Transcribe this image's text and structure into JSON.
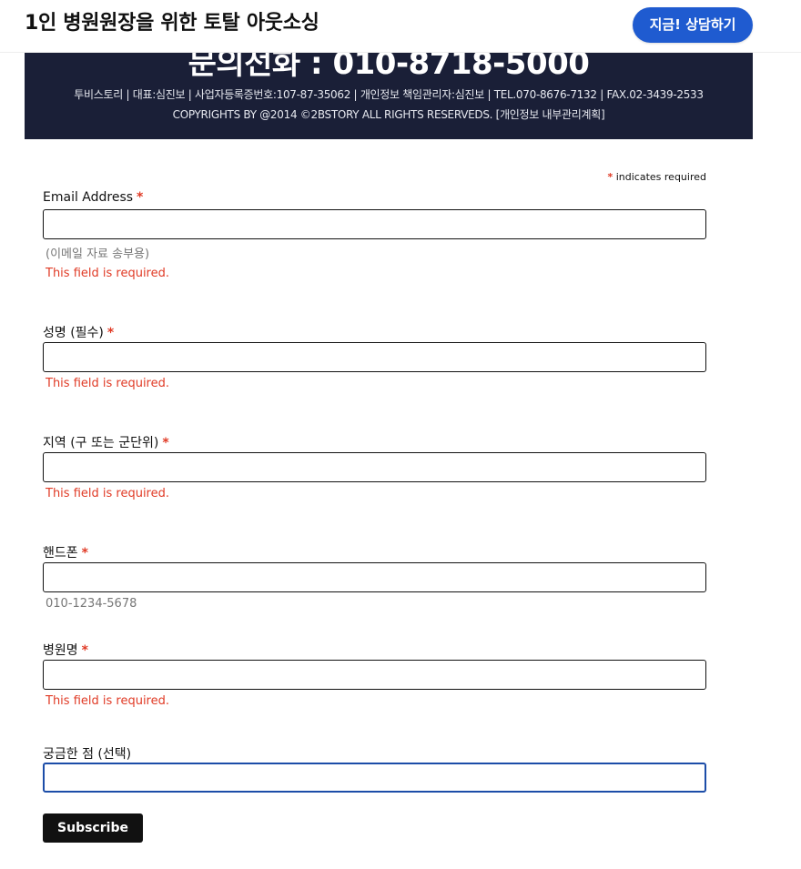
{
  "header": {
    "site_title": "1인 병원원장을 위한 토탈 아웃소싱",
    "cta_label": "지금! 상담하기"
  },
  "banner": {
    "phone": "문의전화 : 010-8718-5000",
    "company_line": "투비스토리 | 대표:심진보 | 사업자등록증번호:107-87-35062 | 개인정보 책임관리자:심진보 | TEL.070-8676-7132 | FAX.02-3439-2533",
    "copyright_line": "COPYRIGHTS BY @2014 ©2BSTORY ALL RIGHTS RESERVEDS. [개인정보 내부관리계획]"
  },
  "form": {
    "required_mark": "*",
    "required_note": "indicates required",
    "fields": [
      {
        "label": "Email Address",
        "required": true,
        "value": "",
        "helper": "(이메일 자료 송부용)",
        "error": "This field is required."
      },
      {
        "label": "성명 (필수)",
        "required": true,
        "value": "",
        "error": "This field is required."
      },
      {
        "label": "지역 (구 또는 군단위)",
        "required": true,
        "value": "",
        "error": "This field is required."
      },
      {
        "label": "핸드폰",
        "required": true,
        "value": "",
        "helper": "010-1234-5678"
      },
      {
        "label": "병원명",
        "required": true,
        "value": "",
        "error": "This field is required."
      },
      {
        "label": "궁금한 점 (선택)",
        "required": false,
        "value": ""
      }
    ],
    "submit_label": "Subscribe"
  },
  "colors": {
    "cta_blue": "#1f5bd0",
    "banner_navy": "#1a1f37",
    "error_red": "#e03a25",
    "focus_blue": "#1c4da8"
  }
}
